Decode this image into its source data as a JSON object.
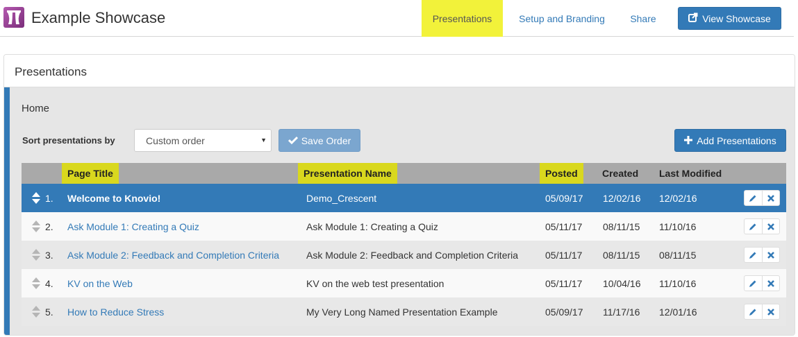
{
  "app": {
    "title": "Example Showcase"
  },
  "nav": {
    "tabs": [
      {
        "label": "Presentations",
        "active": true
      },
      {
        "label": "Setup and Branding",
        "active": false
      },
      {
        "label": "Share",
        "active": false
      }
    ],
    "view_button": "View Showcase"
  },
  "panel": {
    "title": "Presentations",
    "breadcrumb": "Home",
    "sort_label": "Sort presentations by",
    "sort_value": "Custom order",
    "save_order": "Save Order",
    "add_presentations": "Add Presentations"
  },
  "table": {
    "headers": {
      "page_title": "Page Title",
      "presentation_name": "Presentation Name",
      "posted": "Posted",
      "created": "Created",
      "last_modified": "Last Modified"
    },
    "rows": [
      {
        "num": "1.",
        "title": "Welcome to Knovio!",
        "name": "Demo_Crescent",
        "posted": "05/09/17",
        "created": "12/02/16",
        "modified": "12/02/16",
        "selected": true
      },
      {
        "num": "2.",
        "title": "Ask Module 1: Creating a Quiz",
        "name": "Ask Module 1: Creating a Quiz",
        "posted": "05/11/17",
        "created": "08/11/15",
        "modified": "11/10/16",
        "selected": false
      },
      {
        "num": "3.",
        "title": "Ask Module 2: Feedback and Completion Criteria",
        "name": "Ask Module 2: Feedback and Completion Criteria",
        "posted": "05/11/17",
        "created": "08/11/15",
        "modified": "08/11/15",
        "selected": false
      },
      {
        "num": "4.",
        "title": "KV on the Web",
        "name": "KV on the web test presentation",
        "posted": "05/11/17",
        "created": "10/04/16",
        "modified": "11/10/16",
        "selected": false
      },
      {
        "num": "5.",
        "title": "How to Reduce Stress",
        "name": "My Very Long Named Presentation Example",
        "posted": "05/09/17",
        "created": "11/17/16",
        "modified": "12/01/16",
        "selected": false
      }
    ]
  },
  "colors": {
    "primary": "#337ab7",
    "highlight": "#f2f23a",
    "header_highlight": "#d9d81e"
  },
  "icons": {
    "logo": "theater-curtain-icon",
    "view": "external-link-icon",
    "save": "check-icon",
    "add": "plus-icon",
    "drag": "sort-arrows-icon",
    "edit": "pencil-icon",
    "delete": "x-icon"
  }
}
